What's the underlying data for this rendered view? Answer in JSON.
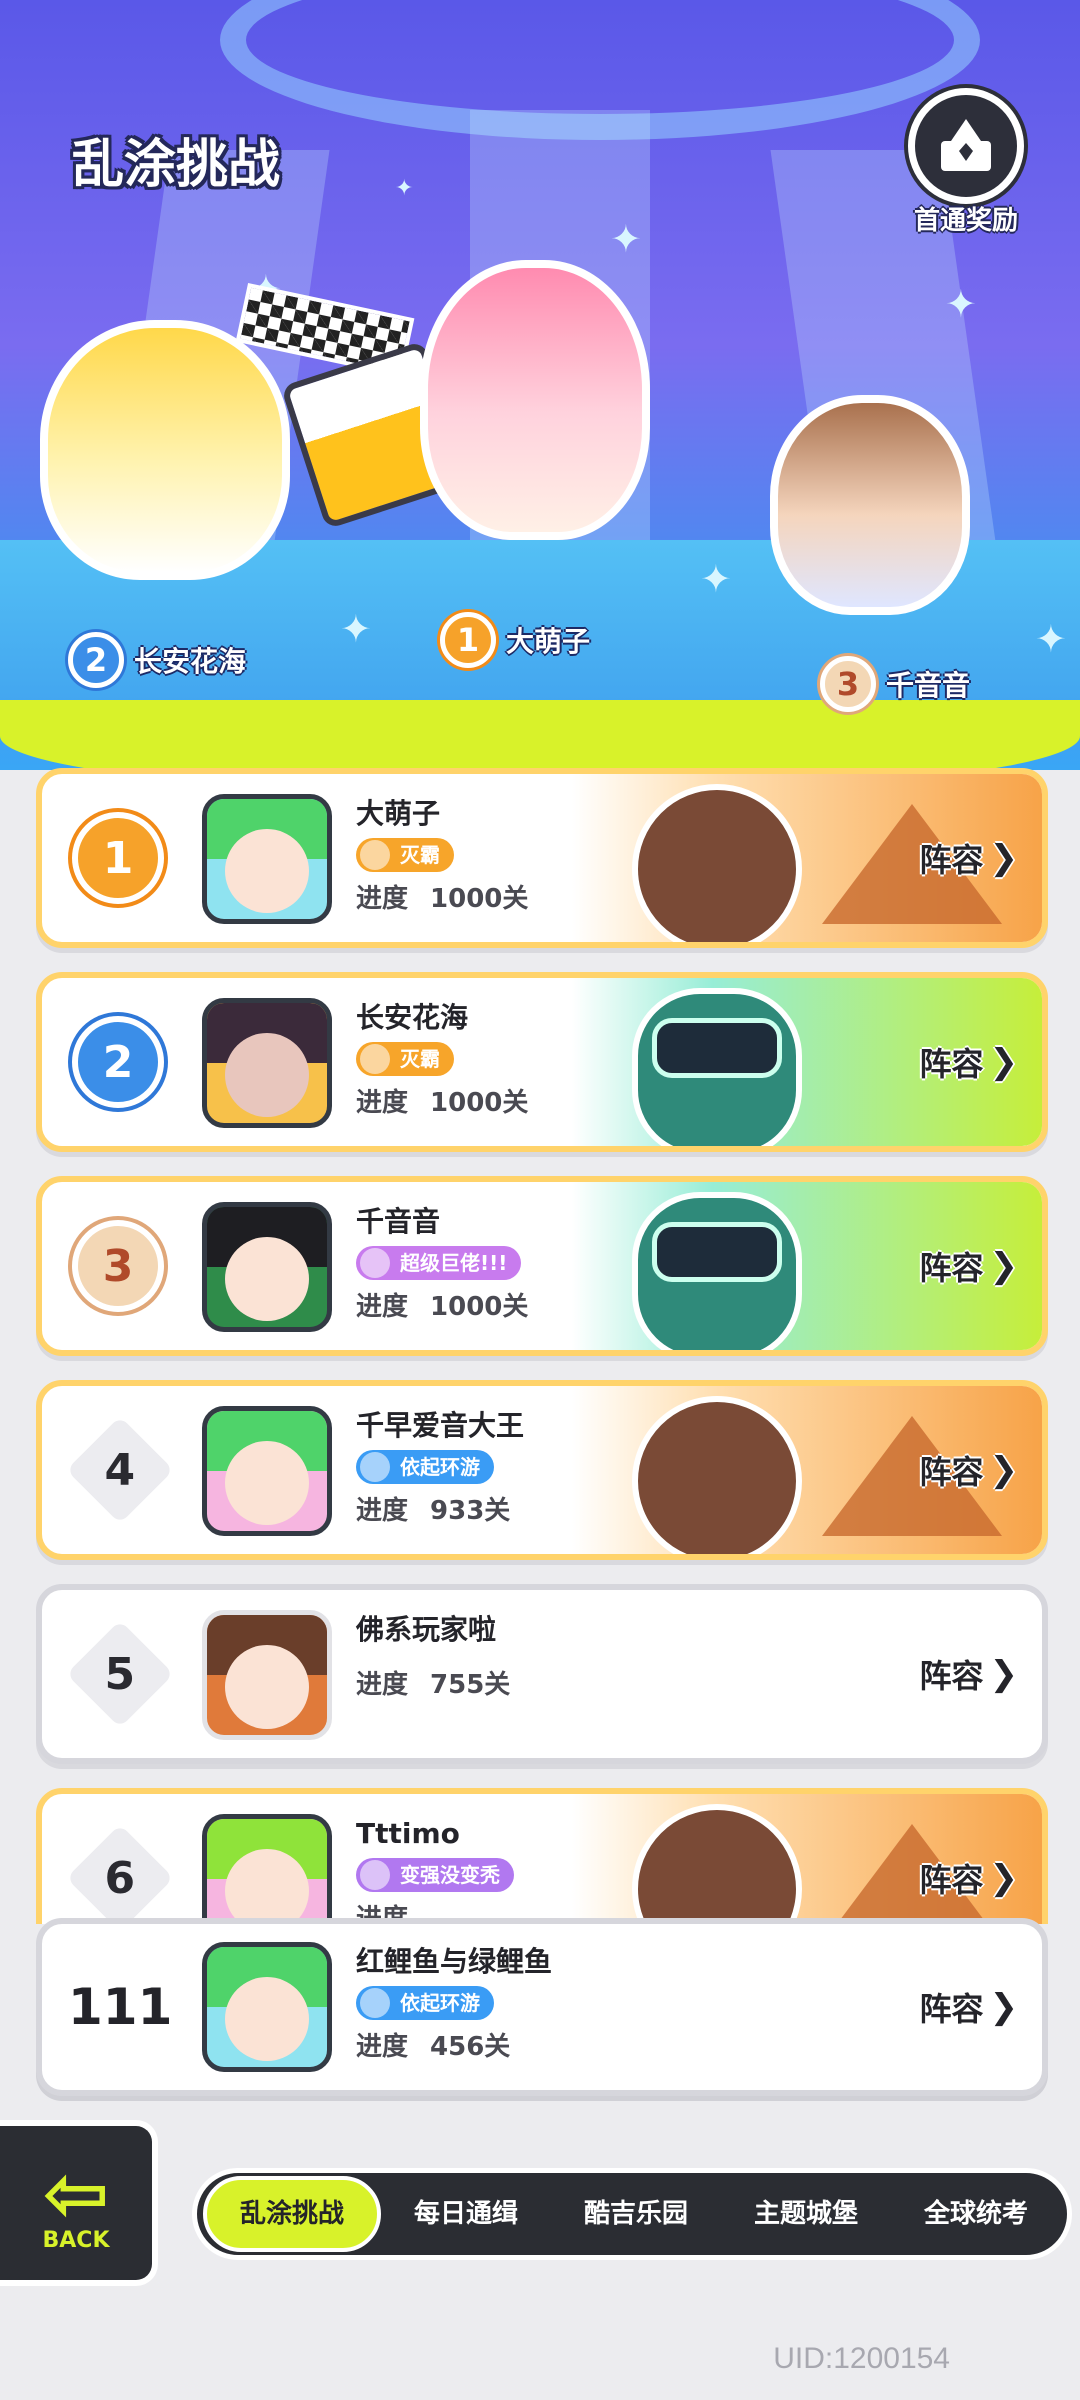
{
  "header": {
    "title": "乱涂挑战",
    "first_reward_label": "首通奖励"
  },
  "podium": [
    {
      "rank": "1",
      "name": "大萌子"
    },
    {
      "rank": "2",
      "name": "长安花海"
    },
    {
      "rank": "3",
      "name": "千音音"
    }
  ],
  "rankings": [
    {
      "rank": "1",
      "name": "大萌子",
      "badge": "灭霸",
      "progress_label": "进度",
      "progress": "1000关",
      "lineup": "阵容"
    },
    {
      "rank": "2",
      "name": "长安花海",
      "badge": "灭霸",
      "progress_label": "进度",
      "progress": "1000关",
      "lineup": "阵容"
    },
    {
      "rank": "3",
      "name": "千音音",
      "badge": "超级巨佬!!!",
      "progress_label": "进度",
      "progress": "1000关",
      "lineup": "阵容"
    },
    {
      "rank": "4",
      "name": "千早爱音大王",
      "badge": "依起环游",
      "progress_label": "进度",
      "progress": "933关",
      "lineup": "阵容"
    },
    {
      "rank": "5",
      "name": "佛系玩家啦",
      "badge": "",
      "progress_label": "进度",
      "progress": "755关",
      "lineup": "阵容"
    },
    {
      "rank": "6",
      "name": "Tttimo",
      "badge": "变强没变秃",
      "progress_label": "进度",
      "progress": "",
      "lineup": "阵容"
    }
  ],
  "my_rank": {
    "rank": "111",
    "name": "红鲤鱼与绿鲤鱼",
    "badge": "依起环游",
    "progress_label": "进度",
    "progress": "456关",
    "lineup": "阵容"
  },
  "nav": {
    "back_label": "BACK",
    "tabs": [
      "乱涂挑战",
      "每日通缉",
      "酷吉乐园",
      "主题城堡",
      "全球统考"
    ],
    "active_tab": "乱涂挑战"
  },
  "uid": "UID:1200154",
  "colors": {
    "accent_lime": "#d8f22a",
    "gold": "#f6a22a",
    "silver_blue": "#3b8ee8",
    "bronze": "#f3d7b5",
    "dark": "#2b2d33"
  },
  "icons": [
    "trophy-box-icon",
    "chevron-right-icon",
    "back-arrow-icon",
    "sparkle-icon"
  ]
}
